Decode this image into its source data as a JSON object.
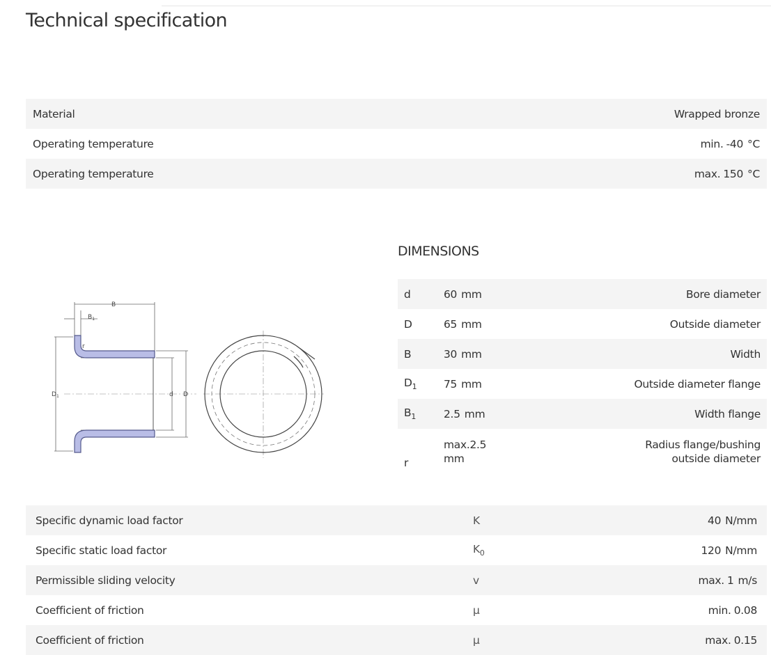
{
  "title": "Technical specification",
  "general": [
    {
      "label": "Material",
      "value": "Wrapped bronze",
      "shade": true
    },
    {
      "label": "Operating temperature",
      "prefix": "min.",
      "value": "-40",
      "unit": "°C",
      "shade": false
    },
    {
      "label": "Operating temperature",
      "prefix": "max.",
      "value": "150",
      "unit": "°C",
      "shade": true
    }
  ],
  "dimensions": {
    "title": "DIMENSIONS",
    "rows": [
      {
        "symbol": "d",
        "value": "60",
        "unit": "mm",
        "description": "Bore diameter"
      },
      {
        "symbol": "D",
        "value": "65",
        "unit": "mm",
        "description": "Outside diameter"
      },
      {
        "symbol": "B",
        "value": "30",
        "unit": "mm",
        "description": "Width"
      },
      {
        "symbol": "D",
        "sub": "1",
        "value": "75",
        "unit": "mm",
        "description": "Outside diameter flange"
      },
      {
        "symbol": "B",
        "sub": "1",
        "value": "2.5",
        "unit": "mm",
        "description": "Width flange"
      },
      {
        "symbol": "r",
        "value": "max.2.5",
        "unit": "mm",
        "description_line1": "Radius flange/bushing",
        "description_line2": "outside diameter"
      }
    ]
  },
  "drawing_labels": {
    "B": "B",
    "B1": "B",
    "B1_sub": "1",
    "r": "r",
    "D1": "D",
    "D1_sub": "1",
    "d": "d",
    "D": "D"
  },
  "load": [
    {
      "label": "Specific dynamic load factor",
      "symbol": "K",
      "value": "40",
      "unit": "N/mm"
    },
    {
      "label": "Specific static load factor",
      "symbol": "K",
      "symbol_sub": "0",
      "value": "120",
      "unit": "N/mm"
    },
    {
      "label": "Permissible sliding velocity",
      "symbol": "v",
      "prefix": "max.",
      "value": "1",
      "unit": "m/s"
    },
    {
      "label": "Coefficient of friction",
      "symbol": "μ",
      "prefix": "min.",
      "value": "0.08"
    },
    {
      "label": "Coefficient of friction",
      "symbol": "μ",
      "prefix": "max.",
      "value": "0.15"
    }
  ],
  "colors": {
    "row_shade": "#f4f4f4",
    "bearing_fill": "#b9bde6",
    "bearing_stroke": "#555a8c"
  }
}
